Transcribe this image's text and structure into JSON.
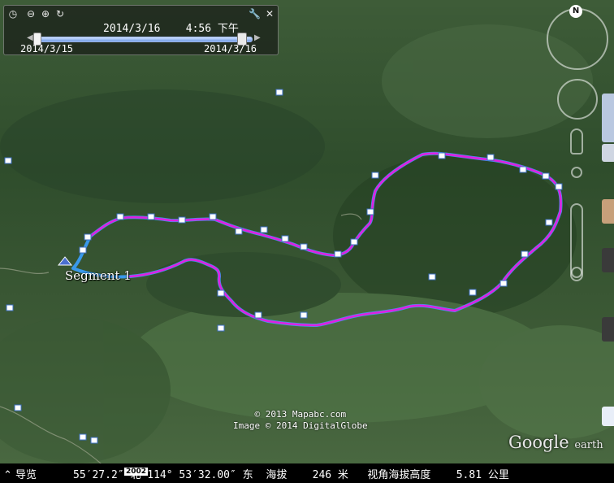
{
  "time_slider": {
    "current_date": "2014/3/16",
    "current_time": "4:56 下午",
    "start_date": "2014/3/15",
    "end_date": "2014/3/16"
  },
  "map": {
    "track_label": "Segment 1",
    "copyright_lines": [
      "© 2013 Mapabc.com",
      "Image © 2014 DigitalGlobe"
    ],
    "brand": "Google",
    "brand_suffix": "earth",
    "track_colors": {
      "primary": "#e020e0",
      "secondary": "#3aa0ff"
    }
  },
  "navigation": {
    "north_label": "N"
  },
  "status_bar": {
    "nav_label": "导览",
    "coordinates": "55′27.2″ 北 114° 53′32.00″ 东  海拔    246 米   视角海拔高度    5.81 公里",
    "year_badge": "2002"
  }
}
